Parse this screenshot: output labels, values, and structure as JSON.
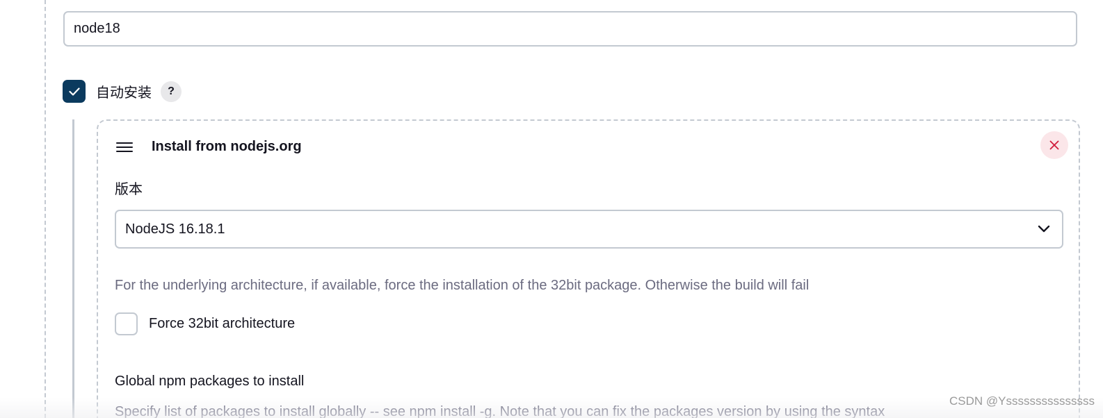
{
  "tool_name": {
    "value": "node18"
  },
  "auto_install": {
    "label": "自动安装",
    "checked": true,
    "help_label": "?"
  },
  "installer": {
    "title": "Install from nodejs.org",
    "version": {
      "label": "版本",
      "selected": "NodeJS 16.18.1"
    },
    "force32": {
      "description": "For the underlying architecture, if available, force the installation of the 32bit package. Otherwise the build will fail",
      "label": "Force 32bit architecture",
      "checked": false
    },
    "npm_packages": {
      "label": "Global npm packages to install",
      "description": "Specify list of packages to install globally -- see npm install -g. Note that you can fix the packages version by using the syntax"
    }
  },
  "watermark": "CSDN @Ysssssssssssssss",
  "colors": {
    "accent": "#0b3a5e",
    "border": "#c3c9d1",
    "muted_text": "#6b6b80",
    "danger": "#d01b3b",
    "danger_bg": "#fbe6e9"
  },
  "icons": {
    "checkbox": "check-icon",
    "drag": "hamburger-icon",
    "close": "close-icon",
    "select": "chevron-down-icon"
  }
}
